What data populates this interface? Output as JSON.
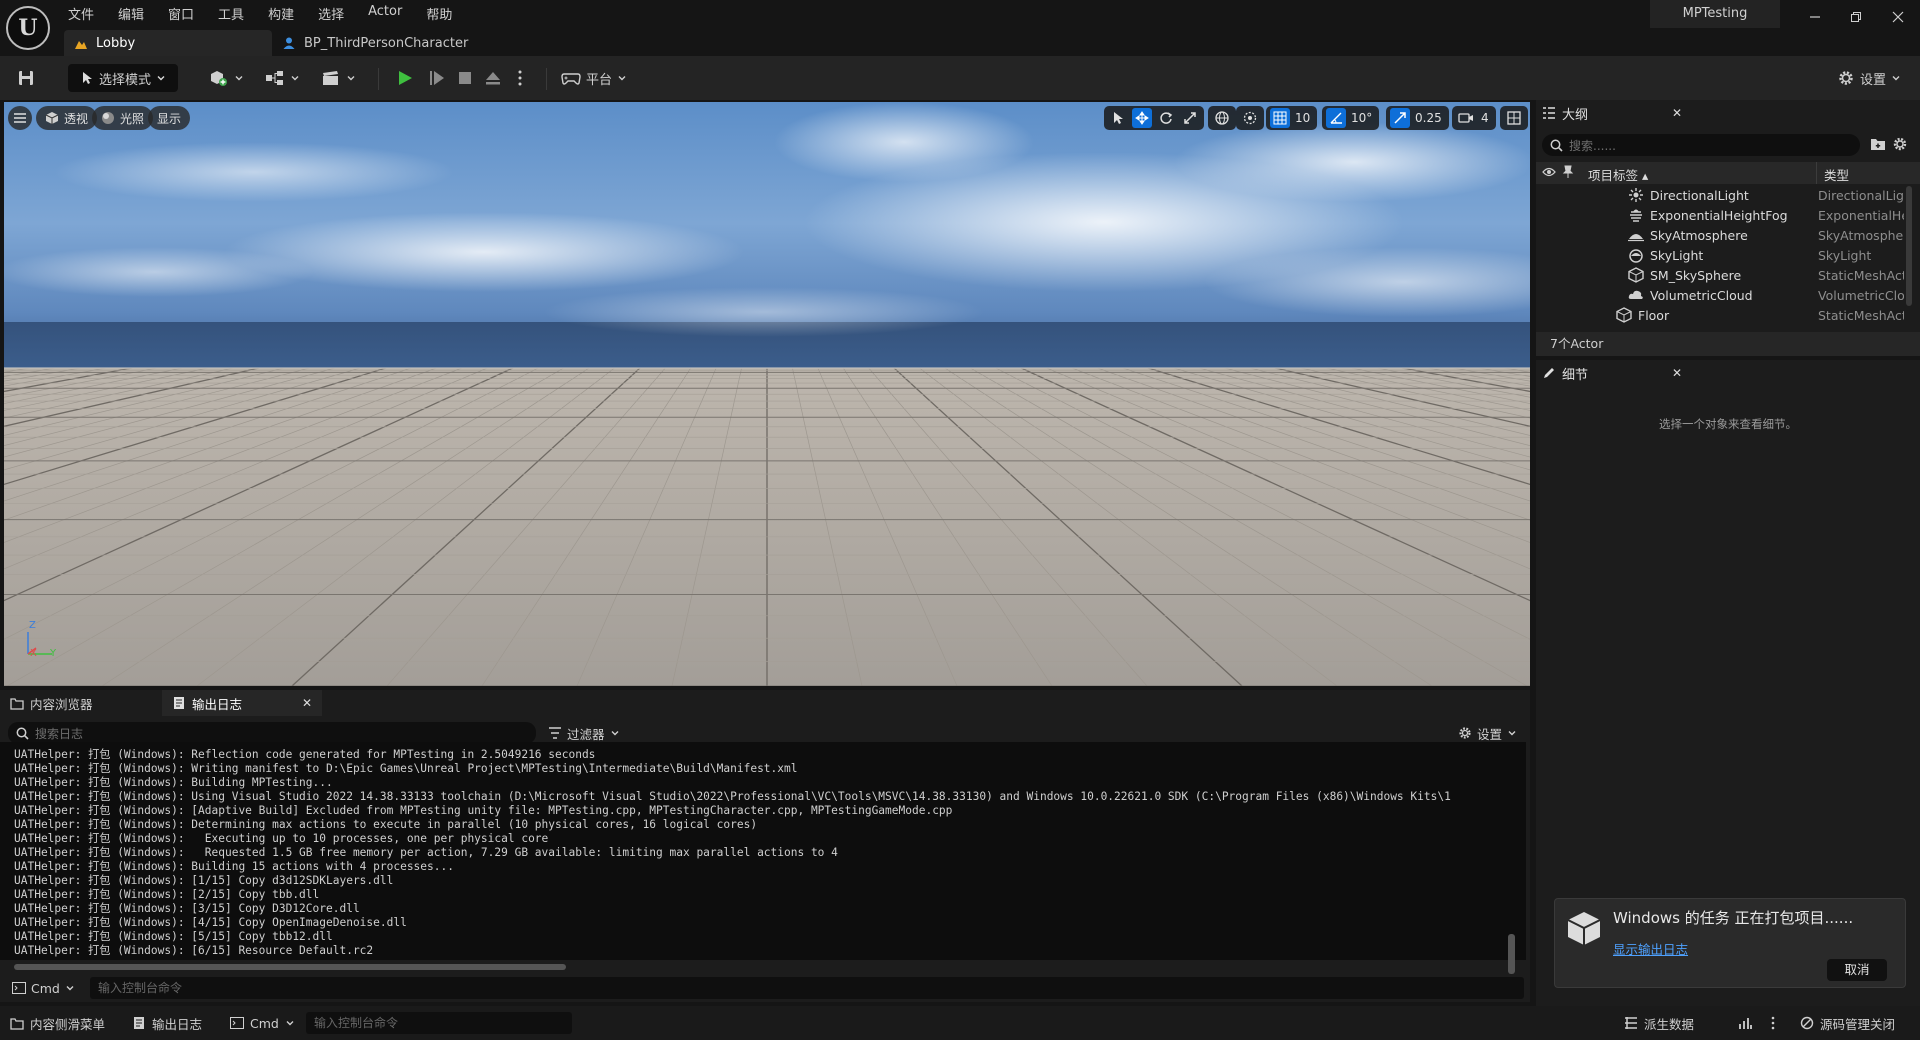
{
  "app": {
    "project_title": "MPTesting",
    "menu": [
      "文件",
      "编辑",
      "窗口",
      "工具",
      "构建",
      "选择",
      "Actor",
      "帮助"
    ],
    "tabs": [
      {
        "label": "Lobby",
        "active": true
      },
      {
        "label": "BP_ThirdPersonCharacter",
        "active": false
      }
    ],
    "window_controls": [
      "minimize",
      "restore",
      "close"
    ]
  },
  "toolbar": {
    "mode_select": "选择模式",
    "platform": "平台",
    "settings": "设置"
  },
  "viewport": {
    "perspective": "透视",
    "lighting": "光照",
    "show": "显示",
    "grid_snap": "10",
    "rotation_snap": "10°",
    "scale_snap": "0.25",
    "camera_speed": "4",
    "axis_labels": {
      "z": "Z",
      "x": "X",
      "y": "Y"
    }
  },
  "outliner": {
    "title": "大纲",
    "search_placeholder": "搜索......",
    "col_label": "项目标签",
    "col_type": "类型",
    "rows": [
      {
        "name": "DirectionalLight",
        "type": "DirectionalLight",
        "icon": "directional-light-icon"
      },
      {
        "name": "ExponentialHeightFog",
        "type": "ExponentialHeightFog",
        "icon": "fog-icon"
      },
      {
        "name": "SkyAtmosphere",
        "type": "SkyAtmosphere",
        "icon": "sky-atmosphere-icon"
      },
      {
        "name": "SkyLight",
        "type": "SkyLight",
        "icon": "sky-light-icon"
      },
      {
        "name": "SM_SkySphere",
        "type": "StaticMeshActor",
        "icon": "static-mesh-icon"
      },
      {
        "name": "VolumetricCloud",
        "type": "VolumetricCloud",
        "icon": "cloud-icon"
      },
      {
        "name": "Floor",
        "type": "StaticMeshActor",
        "icon": "static-mesh-icon"
      }
    ],
    "actor_count": "7个Actor"
  },
  "details": {
    "title": "细节",
    "empty_message": "选择一个对象来查看细节。"
  },
  "bottom_panel": {
    "tab_content_browser": "内容浏览器",
    "tab_output_log": "输出日志",
    "search_placeholder": "搜索日志",
    "filter": "过滤器",
    "settings": "设置",
    "log_lines": [
      "UATHelper: 打包 (Windows): Reflection code generated for MPTesting in 2.5049216 seconds",
      "UATHelper: 打包 (Windows): Writing manifest to D:\\Epic Games\\Unreal Project\\MPTesting\\Intermediate\\Build\\Manifest.xml",
      "UATHelper: 打包 (Windows): Building MPTesting...",
      "UATHelper: 打包 (Windows): Using Visual Studio 2022 14.38.33133 toolchain (D:\\Microsoft Visual Studio\\2022\\Professional\\VC\\Tools\\MSVC\\14.38.33130) and Windows 10.0.22621.0 SDK (C:\\Program Files (x86)\\Windows Kits\\1",
      "UATHelper: 打包 (Windows): [Adaptive Build] Excluded from MPTesting unity file: MPTesting.cpp, MPTestingCharacter.cpp, MPTestingGameMode.cpp",
      "UATHelper: 打包 (Windows): Determining max actions to execute in parallel (10 physical cores, 16 logical cores)",
      "UATHelper: 打包 (Windows):   Executing up to 10 processes, one per physical core",
      "UATHelper: 打包 (Windows):   Requested 1.5 GB free memory per action, 7.29 GB available: limiting max parallel actions to 4",
      "UATHelper: 打包 (Windows): Building 15 actions with 4 processes...",
      "UATHelper: 打包 (Windows): [1/15] Copy d3d12SDKLayers.dll",
      "UATHelper: 打包 (Windows): [2/15] Copy tbb.dll",
      "UATHelper: 打包 (Windows): [3/15] Copy D3D12Core.dll",
      "UATHelper: 打包 (Windows): [4/15] Copy OpenImageDenoise.dll",
      "UATHelper: 打包 (Windows): [5/15] Copy tbb12.dll",
      "UATHelper: 打包 (Windows): [6/15] Resource Default.rc2"
    ],
    "cmd_label": "Cmd",
    "cmd_placeholder": "输入控制台命令"
  },
  "toast": {
    "title": "Windows 的任务 正在打包项目......",
    "link": "显示输出日志",
    "cancel": "取消"
  },
  "statusbar": {
    "content_drawer": "内容侧滑菜单",
    "output_log": "输出日志",
    "cmd_label": "Cmd",
    "cmd_placeholder": "输入控制台命令",
    "derived_data": "派生数据",
    "source_control": "源码管理关闭"
  }
}
